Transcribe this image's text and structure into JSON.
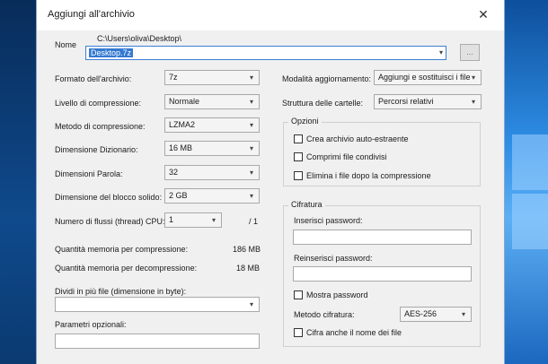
{
  "window": {
    "title": "Aggiungi all'archivio",
    "close_glyph": "✕"
  },
  "name": {
    "label": "Nome",
    "path": "C:\\Users\\oliva\\Desktop\\",
    "value": "Desktop.7z",
    "browse_label": "..."
  },
  "left": {
    "archive_format": {
      "label": "Formato dell'archivio:",
      "value": "7z"
    },
    "compression_level": {
      "label": "Livello di compressione:",
      "value": "Normale"
    },
    "compression_method": {
      "label": "Metodo di compressione:",
      "value": "LZMA2"
    },
    "dictionary_size": {
      "label": "Dimensione Dizionario:",
      "value": "16 MB"
    },
    "word_size": {
      "label": "Dimensioni Parola:",
      "value": "32"
    },
    "solid_block_size": {
      "label": "Dimensione del blocco solido:",
      "value": "2 GB"
    },
    "threads": {
      "label": "Numero di flussi (thread) CPU:",
      "value": "1",
      "total": "/ 1"
    },
    "memory_compression": {
      "label": "Quantità memoria per compressione:",
      "value": "186 MB"
    },
    "memory_decompression": {
      "label": "Quantità memoria per decompressione:",
      "value": "18 MB"
    },
    "split": {
      "label": "Dividi in più file (dimensione in byte):",
      "value": ""
    },
    "params": {
      "label": "Parametri opzionali:",
      "value": ""
    }
  },
  "right": {
    "update_mode": {
      "label": "Modalità aggiornamento:",
      "value": "Aggiungi e sostituisci i file"
    },
    "path_mode": {
      "label": "Struttura delle cartelle:",
      "value": "Percorsi relativi"
    },
    "options": {
      "title": "Opzioni",
      "items": [
        {
          "label": "Crea archivio auto-estraente",
          "checked": false
        },
        {
          "label": "Comprimi file condivisi",
          "checked": false
        },
        {
          "label": "Elimina i file dopo la compressione",
          "checked": false
        }
      ]
    },
    "encryption": {
      "title": "Cifratura",
      "password_label": "Inserisci password:",
      "password_value": "",
      "repeat_label": "Reinserisci password:",
      "repeat_value": "",
      "show_password_label": "Mostra password",
      "method_label": "Metodo cifratura:",
      "method_value": "AES-256",
      "encrypt_names_label": "Cifra anche il nome dei file"
    }
  },
  "colors": {
    "accent": "#3479d1",
    "dialog_bg": "#f0f0f0",
    "desktop_blue": "#1d6fc4"
  }
}
